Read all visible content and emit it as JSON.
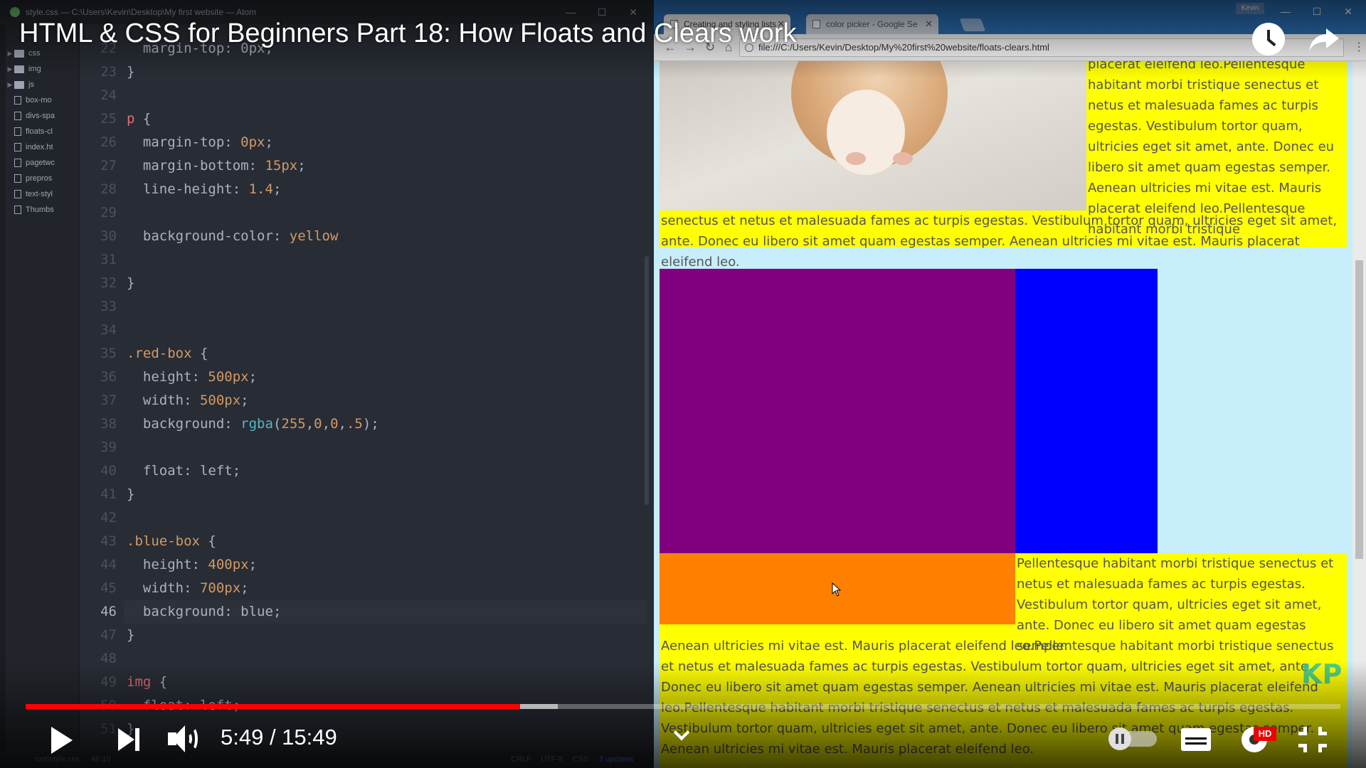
{
  "atom": {
    "title": "style.css — C:\\Users\\Kevin\\Desktop\\My first website — Atom",
    "window_controls": [
      "—",
      "☐",
      "✕"
    ],
    "tree": {
      "folders": [
        "css",
        "img",
        "js"
      ],
      "files": [
        "box-mo",
        "divs-spa",
        "floats-cl",
        "index.ht",
        "pagetwc",
        "prepros",
        "text-styl",
        "Thumbs"
      ]
    },
    "code_lines": [
      {
        "no": "22",
        "tokens": [
          {
            "t": "  margin-top: 0px;",
            "c": "prop"
          }
        ]
      },
      {
        "no": "23",
        "tokens": [
          {
            "t": "}",
            "c": "punc"
          }
        ]
      },
      {
        "no": "24",
        "tokens": []
      },
      {
        "no": "25",
        "tokens": [
          {
            "t": "p",
            "c": "sel"
          },
          {
            "t": " {",
            "c": "punc"
          }
        ]
      },
      {
        "no": "26",
        "tokens": [
          {
            "t": "  margin-top",
            "c": "prop"
          },
          {
            "t": ": ",
            "c": "punc"
          },
          {
            "t": "0px",
            "c": "num"
          },
          {
            "t": ";",
            "c": "punc"
          }
        ]
      },
      {
        "no": "27",
        "tokens": [
          {
            "t": "  margin-bottom",
            "c": "prop"
          },
          {
            "t": ": ",
            "c": "punc"
          },
          {
            "t": "15px",
            "c": "num"
          },
          {
            "t": ";",
            "c": "punc"
          }
        ]
      },
      {
        "no": "28",
        "tokens": [
          {
            "t": "  line-height",
            "c": "prop"
          },
          {
            "t": ": ",
            "c": "punc"
          },
          {
            "t": "1.4",
            "c": "num"
          },
          {
            "t": ";",
            "c": "punc"
          }
        ]
      },
      {
        "no": "29",
        "tokens": []
      },
      {
        "no": "30",
        "tokens": [
          {
            "t": "  background-color",
            "c": "prop"
          },
          {
            "t": ": ",
            "c": "punc"
          },
          {
            "t": "yellow",
            "c": "kw"
          }
        ]
      },
      {
        "no": "31",
        "tokens": []
      },
      {
        "no": "32",
        "tokens": [
          {
            "t": "}",
            "c": "punc"
          }
        ]
      },
      {
        "no": "33",
        "tokens": []
      },
      {
        "no": "34",
        "tokens": []
      },
      {
        "no": "35",
        "tokens": [
          {
            "t": ".red-box",
            "c": "cls"
          },
          {
            "t": " {",
            "c": "punc"
          }
        ]
      },
      {
        "no": "36",
        "tokens": [
          {
            "t": "  height",
            "c": "prop"
          },
          {
            "t": ": ",
            "c": "punc"
          },
          {
            "t": "500px",
            "c": "num"
          },
          {
            "t": ";",
            "c": "punc"
          }
        ]
      },
      {
        "no": "37",
        "tokens": [
          {
            "t": "  width",
            "c": "prop"
          },
          {
            "t": ": ",
            "c": "punc"
          },
          {
            "t": "500px",
            "c": "num"
          },
          {
            "t": ";",
            "c": "punc"
          }
        ]
      },
      {
        "no": "38",
        "tokens": [
          {
            "t": "  background",
            "c": "prop"
          },
          {
            "t": ": ",
            "c": "punc"
          },
          {
            "t": "rgba",
            "c": "fn"
          },
          {
            "t": "(",
            "c": "punc"
          },
          {
            "t": "255",
            "c": "num"
          },
          {
            "t": ",",
            "c": "punc"
          },
          {
            "t": "0",
            "c": "num"
          },
          {
            "t": ",",
            "c": "punc"
          },
          {
            "t": "0",
            "c": "num"
          },
          {
            "t": ",",
            "c": "punc"
          },
          {
            "t": ".5",
            "c": "num"
          },
          {
            "t": ");",
            "c": "punc"
          }
        ]
      },
      {
        "no": "39",
        "tokens": []
      },
      {
        "no": "40",
        "tokens": [
          {
            "t": "  float",
            "c": "prop"
          },
          {
            "t": ": ",
            "c": "punc"
          },
          {
            "t": "left",
            "c": "prop"
          },
          {
            "t": ";",
            "c": "punc"
          }
        ]
      },
      {
        "no": "41",
        "tokens": [
          {
            "t": "}",
            "c": "punc"
          }
        ]
      },
      {
        "no": "42",
        "tokens": []
      },
      {
        "no": "43",
        "tokens": [
          {
            "t": ".blue-box",
            "c": "cls"
          },
          {
            "t": " {",
            "c": "punc"
          }
        ]
      },
      {
        "no": "44",
        "tokens": [
          {
            "t": "  height",
            "c": "prop"
          },
          {
            "t": ": ",
            "c": "punc"
          },
          {
            "t": "400px",
            "c": "num"
          },
          {
            "t": ";",
            "c": "punc"
          }
        ]
      },
      {
        "no": "45",
        "tokens": [
          {
            "t": "  width",
            "c": "prop"
          },
          {
            "t": ": ",
            "c": "punc"
          },
          {
            "t": "700px",
            "c": "num"
          },
          {
            "t": ";",
            "c": "punc"
          }
        ]
      },
      {
        "no": "46",
        "tokens": [
          {
            "t": "  background",
            "c": "prop"
          },
          {
            "t": ": ",
            "c": "punc"
          },
          {
            "t": "blue",
            "c": "prop"
          },
          {
            "t": ";",
            "c": "punc"
          }
        ],
        "active": true
      },
      {
        "no": "47",
        "tokens": [
          {
            "t": "}",
            "c": "punc"
          }
        ]
      },
      {
        "no": "48",
        "tokens": []
      },
      {
        "no": "49",
        "tokens": [
          {
            "t": "img",
            "c": "sel"
          },
          {
            "t": " {",
            "c": "punc"
          }
        ]
      },
      {
        "no": "50",
        "tokens": [
          {
            "t": "  float: left;",
            "c": "prop"
          }
        ]
      },
      {
        "no": "51",
        "tokens": [
          {
            "t": "}",
            "c": "punc"
          }
        ]
      }
    ],
    "status": {
      "file": "css\\style.css",
      "cursor": "46:10",
      "line_ending": "CRLF",
      "encoding": "UTF-8",
      "grammar": "CSS",
      "updates": "3 updates"
    }
  },
  "chrome": {
    "tabs": [
      {
        "label": "Creating and styling lists",
        "active": true
      },
      {
        "label": "color picker - Google Se",
        "active": false
      }
    ],
    "user": "Kevin",
    "window_controls": [
      "—",
      "☐",
      "✕"
    ],
    "nav": {
      "back": "←",
      "forward": "→",
      "reload": "↻",
      "home": "⌂"
    },
    "url": "file:///C:/Users/Kevin/Desktop/My%20first%20website/floats-clears.html",
    "menu": "⋮",
    "page": {
      "para1_right": "placerat eleifend leo.Pellentesque habitant morbi tristique senectus et netus et malesuada fames ac turpis egestas. Vestibulum tortor quam, ultricies eget sit amet, ante. Donec eu libero sit amet quam egestas semper. Aenean ultricies mi vitae est. Mauris placerat eleifend leo.Pellentesque habitant morbi tristique",
      "para1_bottom": "senectus et netus et malesuada fames ac turpis egestas. Vestibulum tortor quam, ultricies eget sit amet, ante. Donec eu libero sit amet quam egestas semper. Aenean ultricies mi vitae est. Mauris placerat eleifend leo.",
      "para2_right": "Pellentesque habitant morbi tristique senectus et netus et malesuada fames ac turpis egestas. Vestibulum tortor quam, ultricies eget sit amet, ante. Donec eu libero sit amet quam egestas semper.",
      "para2_bottom": "Aenean ultricies mi vitae est. Mauris placerat eleifend leo.Pellentesque habitant morbi tristique senectus et netus et malesuada fames ac turpis egestas. Vestibulum tortor quam, ultricies eget sit amet, ante. Donec eu libero sit amet quam egestas semper. Aenean ultricies mi vitae est. Mauris placerat eleifend leo.Pellentesque habitant morbi tristique senectus et netus et malesuada fames ac turpis egestas. Vestibulum tortor quam, ultricies eget sit amet, ante. Donec eu libero sit amet quam egestas semper. Aenean ultricies mi vitae est. Mauris placerat eleifend leo.",
      "watermark": "KP"
    }
  },
  "player": {
    "title": "HTML & CSS for Beginners Part 18: How Floats and Clears work",
    "time": "5:49 / 15:49",
    "played_fraction": 0.376,
    "loaded_fraction": 0.405,
    "hd_label": "HD",
    "colors": {
      "progress": "#ff0000",
      "hd_badge": "#ee0000"
    }
  }
}
